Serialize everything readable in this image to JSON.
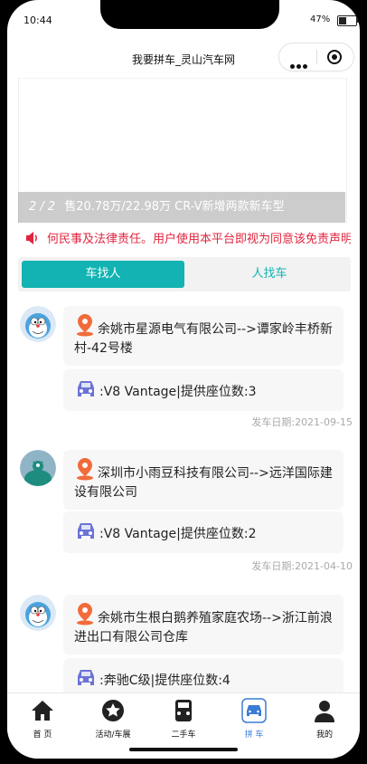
{
  "status": {
    "time": "10:44",
    "battery": "47%",
    "battery_level": 0.47
  },
  "navbar": {
    "title": "我要拼车_灵山汽车网"
  },
  "banner": {
    "index": "2 / 2",
    "caption": "售20.78万/22.98万 CR-V新增两款新车型"
  },
  "notice": {
    "text": "何民事及法律责任。用户使用本平台即视为同意该免责声明"
  },
  "tabs": [
    {
      "label": "车找人"
    },
    {
      "label": "人找车"
    }
  ],
  "items": [
    {
      "route": "余姚市星源电气有限公司-->谭家岭丰桥新村-42号楼",
      "car": ":V8 Vantage|提供座位数:3",
      "date": "发车日期:2021-09-15",
      "avatar": "doraemon-avatar"
    },
    {
      "route": "深圳市小雨豆科技有限公司-->远洋国际建设有限公司",
      "car": ":V8 Vantage|提供座位数:2",
      "date": "发车日期:2021-04-10",
      "avatar": "teal-character-avatar"
    },
    {
      "route": "余姚市生根白鹅养殖家庭农场-->浙江前浪进出口有限公司仓库",
      "car": ":奔驰C级|提供座位数:4",
      "date": "",
      "avatar": "doraemon-avatar"
    }
  ],
  "tabbar": [
    {
      "label": "首 页",
      "icon": "home-icon"
    },
    {
      "label": "活动/车展",
      "icon": "star-icon"
    },
    {
      "label": "二手车",
      "icon": "car-front-icon"
    },
    {
      "label": "拼 车",
      "icon": "carpool-icon",
      "active": true
    },
    {
      "label": "我的",
      "icon": "user-icon"
    }
  ],
  "colors": {
    "accent": "#12b3b2",
    "notice": "#e1253f",
    "pin": "#f26b3a",
    "car": "#6b73d6",
    "tab_active": "#3a7bd5"
  }
}
